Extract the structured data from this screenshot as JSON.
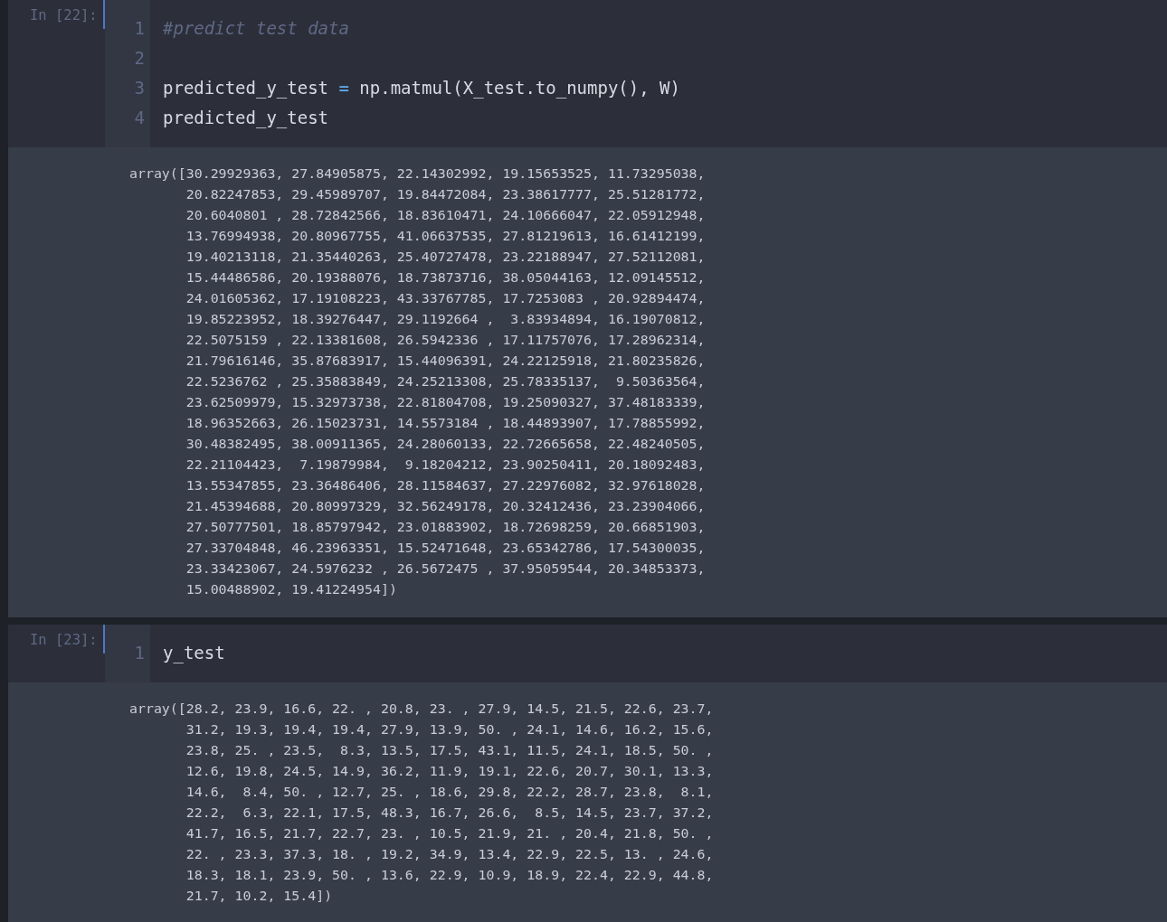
{
  "cells": [
    {
      "prompt": "In [22]:",
      "code_lines": [
        {
          "number": "1",
          "tokens": [
            {
              "kind": "comment",
              "text": "#predict test data"
            }
          ]
        },
        {
          "number": "2"
        },
        {
          "number": "3",
          "tokens": [
            {
              "kind": "plain",
              "text": "predicted_y_test "
            },
            {
              "kind": "operator",
              "text": "="
            },
            {
              "kind": "plain",
              "text": " np.matmul(X_test.to_numpy(), W)"
            }
          ]
        },
        {
          "number": "4",
          "tokens": [
            {
              "kind": "plain",
              "text": "predicted_y_test"
            }
          ]
        }
      ],
      "output_lines": [
        "array([30.29929363, 27.84905875, 22.14302992, 19.15653525, 11.73295038,",
        "       20.82247853, 29.45989707, 19.84472084, 23.38617777, 25.51281772,",
        "       20.6040801 , 28.72842566, 18.83610471, 24.10666047, 22.05912948,",
        "       13.76994938, 20.80967755, 41.06637535, 27.81219613, 16.61412199,",
        "       19.40213118, 21.35440263, 25.40727478, 23.22188947, 27.52112081,",
        "       15.44486586, 20.19388076, 18.73873716, 38.05044163, 12.09145512,",
        "       24.01605362, 17.19108223, 43.33767785, 17.7253083 , 20.92894474,",
        "       19.85223952, 18.39276447, 29.1192664 ,  3.83934894, 16.19070812,",
        "       22.5075159 , 22.13381608, 26.5942336 , 17.11757076, 17.28962314,",
        "       21.79616146, 35.87683917, 15.44096391, 24.22125918, 21.80235826,",
        "       22.5236762 , 25.35883849, 24.25213308, 25.78335137,  9.50363564,",
        "       23.62509979, 15.32973738, 22.81804708, 19.25090327, 37.48183339,",
        "       18.96352663, 26.15023731, 14.5573184 , 18.44893907, 17.78855992,",
        "       30.48382495, 38.00911365, 24.28060133, 22.72665658, 22.48240505,",
        "       22.21104423,  7.19879984,  9.18204212, 23.90250411, 20.18092483,",
        "       13.55347855, 23.36486406, 28.11584637, 27.22976082, 32.97618028,",
        "       21.45394688, 20.80997329, 32.56249178, 20.32412436, 23.23904066,",
        "       27.50777501, 18.85797942, 23.01883902, 18.72698259, 20.66851903,",
        "       27.33704848, 46.23963351, 15.52471648, 23.65342786, 17.54300035,",
        "       23.33423067, 24.5976232 , 26.5672475 , 37.95059544, 20.34853373,",
        "       15.00488902, 19.41224954])"
      ]
    },
    {
      "prompt": "In [23]:",
      "code_lines": [
        {
          "number": "1",
          "tokens": [
            {
              "kind": "plain",
              "text": "y_test"
            }
          ]
        }
      ],
      "output_lines": [
        "array([28.2, 23.9, 16.6, 22. , 20.8, 23. , 27.9, 14.5, 21.5, 22.6, 23.7,",
        "       31.2, 19.3, 19.4, 19.4, 27.9, 13.9, 50. , 24.1, 14.6, 16.2, 15.6,",
        "       23.8, 25. , 23.5,  8.3, 13.5, 17.5, 43.1, 11.5, 24.1, 18.5, 50. ,",
        "       12.6, 19.8, 24.5, 14.9, 36.2, 11.9, 19.1, 22.6, 20.7, 30.1, 13.3,",
        "       14.6,  8.4, 50. , 12.7, 25. , 18.6, 29.8, 22.2, 28.7, 23.8,  8.1,",
        "       22.2,  6.3, 22.1, 17.5, 48.3, 16.7, 26.6,  8.5, 14.5, 23.7, 37.2,",
        "       41.7, 16.5, 21.7, 22.7, 23. , 10.5, 21.9, 21. , 20.4, 21.8, 50. ,",
        "       22. , 23.3, 37.3, 18. , 19.2, 34.9, 13.4, 22.9, 22.5, 13. , 24.6,",
        "       18.3, 18.1, 23.9, 50. , 13.6, 22.9, 10.9, 18.9, 22.4, 22.9, 44.8,",
        "       21.7, 10.2, 15.4])"
      ]
    }
  ]
}
